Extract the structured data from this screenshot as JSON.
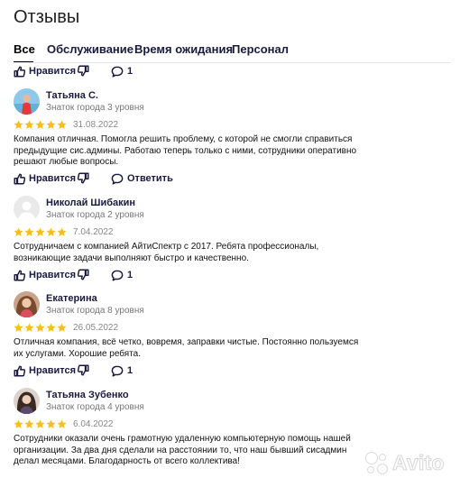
{
  "page": {
    "title": "Отзывы"
  },
  "tabs": [
    {
      "label": "Все",
      "active": true
    },
    {
      "label": "Обслуживание",
      "active": false
    },
    {
      "label": "Время ожидания",
      "active": false
    },
    {
      "label": "Персонал",
      "active": false
    }
  ],
  "top_actions": {
    "like_label": "Нравится",
    "comment_count": "1"
  },
  "reviews": [
    {
      "name": "Татьяна С.",
      "level": "Знаток города 3 уровня",
      "rating": 5,
      "date": "31.08.2022",
      "text": "Компания отличная. Помогла решить проблему, с которой не смогли справиться предыдущие сис.админы. Работаю теперь только с ними, сотрудники оперативно решают любые вопросы.",
      "like_label": "Нравится",
      "reply_label": "Ответить",
      "avatar_icon": "avatar-photo"
    },
    {
      "name": "Николай Шибакин",
      "level": "Знаток города 2 уровня",
      "rating": 5,
      "date": "7.04.2022",
      "text": "Сотрудничаем с компанией АйтиСпектр с 2017. Ребята профессионалы, возникающие задачи выполняют быстро и качественно.",
      "like_label": "Нравится",
      "comment_count": "1",
      "avatar_icon": "default-user-avatar"
    },
    {
      "name": "Екатерина",
      "level": "Знаток города 8 уровня",
      "rating": 5,
      "date": "26.05.2022",
      "text": "Отличная компания, всё четко, вовремя, заправки чистые. Постоянно пользуемся их услугами. Хорошие ребята.",
      "like_label": "Нравится",
      "comment_count": "1",
      "avatar_icon": "avatar-photo"
    },
    {
      "name": "Татьяна Зубенко",
      "level": "Знаток города 4 уровня",
      "rating": 5,
      "date": "6.04.2022",
      "text": "Сотрудники оказали очень грамотную удаленную компьютерную помощь нашей организации. За два дня сделали на расстоянии то, что наш бывший сисадмин делал месяцами. Благодарность от всего коллектива!",
      "avatar_icon": "avatar-photo"
    }
  ],
  "colors": {
    "star": "#f5bf1e",
    "link": "#1a1a40",
    "muted": "#777777"
  },
  "watermark": {
    "text": "Avito"
  }
}
